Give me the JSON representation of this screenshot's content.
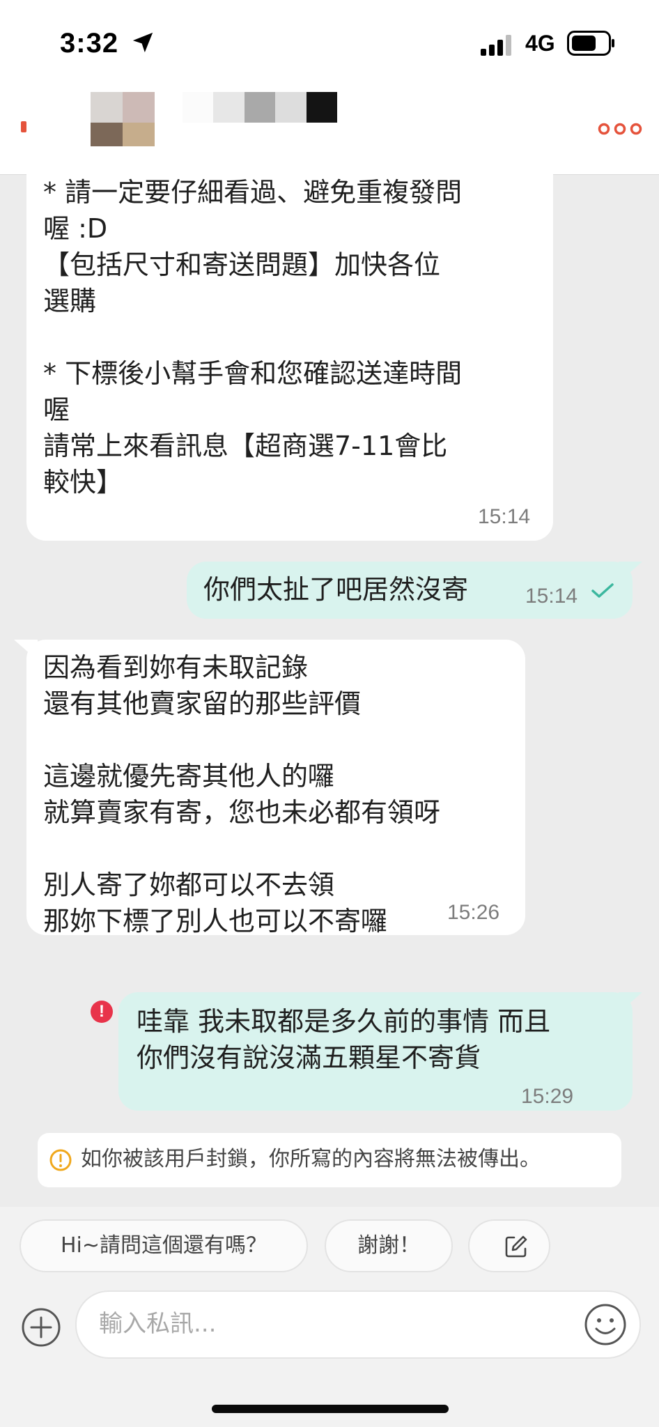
{
  "status_bar": {
    "time": "3:32",
    "network": "4G",
    "location_icon": "location-arrow-icon"
  },
  "header": {
    "avatar_colors": [
      "#d9d5d2",
      "#cdbab6",
      "#7c6858",
      "#c6ad8c"
    ],
    "name_blur_colors": [
      "#fbfbfb",
      "#e7e7e7",
      "#a9a9a9",
      "#dddddd",
      "#141414"
    ],
    "more_icon": "more-dots-icon",
    "accent": "#e5533c"
  },
  "messages": [
    {
      "dir": "in",
      "text": "* 請一定要仔細看過、避免重複發問\n喔 :D\n【包括尺寸和寄送問題】加快各位\n選購\n\n* 下標後小幫手會和您確認送達時間\n喔\n請常上來看訊息【超商選7-11會比\n較快】",
      "time": "15:14"
    },
    {
      "dir": "out",
      "text": "你們太扯了吧居然沒寄",
      "time": "15:14",
      "read": true
    },
    {
      "dir": "in",
      "text": "因為看到妳有未取記錄\n還有其他賣家留的那些評價\n\n這邊就優先寄其他人的囉\n就算賣家有寄，您也未必都有領呀\n\n別人寄了妳都可以不去領\n那妳下標了別人也可以不寄囉",
      "time": "15:26"
    },
    {
      "dir": "out",
      "text": "哇靠 我未取都是多久前的事情 而且\n你們沒有說沒滿五顆星不寄貨",
      "time": "15:29",
      "error": "!"
    }
  ],
  "notice": {
    "text": "如你被該用戶封鎖，你所寫的內容將無法被傳出。",
    "icon": "warning-circle-icon",
    "color": "#f0a81c"
  },
  "quick_replies": [
    "Hi~請問這個還有嗎？",
    "謝謝！"
  ],
  "composer": {
    "placeholder": "輸入私訊...",
    "plus_icon": "plus-circle-icon",
    "emoji_icon": "smiley-icon",
    "edit_icon": "edit-icon"
  },
  "colors": {
    "outgoing_bubble": "#d9f3ee",
    "incoming_bubble": "#ffffff",
    "read_check": "#3bb79e",
    "error": "#e8334a"
  }
}
